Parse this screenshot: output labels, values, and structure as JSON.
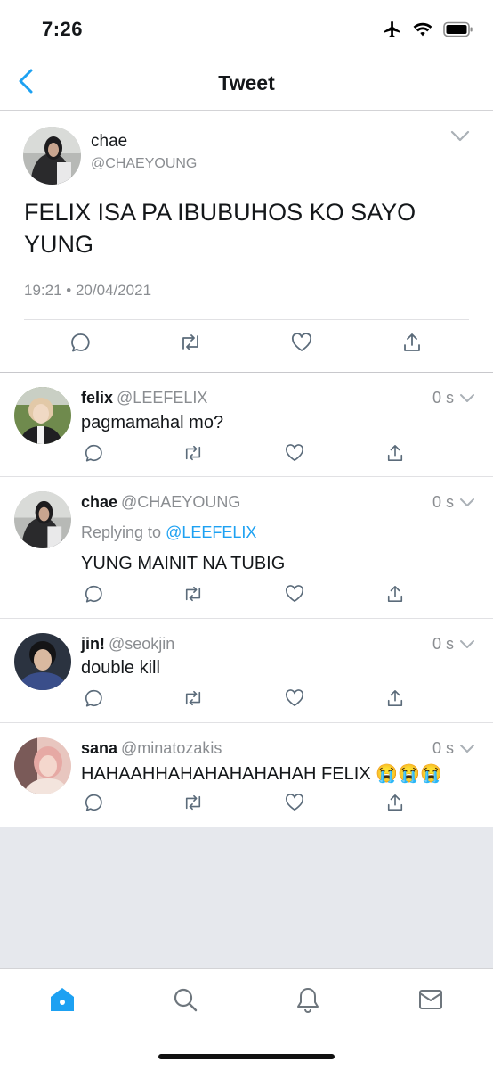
{
  "status_bar": {
    "time": "7:26"
  },
  "nav": {
    "title": "Tweet"
  },
  "main_tweet": {
    "name": "chae",
    "handle": "@CHAEYOUNG",
    "text": "FELIX ISA PA IBUBUHOS KO SAYO YUNG",
    "timestamp": "19:21 • 20/04/2021"
  },
  "replies": [
    {
      "name": "felix",
      "handle": "@LEEFELIX",
      "age": "0 s",
      "text": "pagmamahal mo?"
    },
    {
      "name": "chae",
      "handle": "@CHAEYOUNG",
      "age": "0 s",
      "replying_prefix": "Replying to",
      "replying_to": "@LEEFELIX",
      "text": "YUNG MAINIT NA TUBIG"
    },
    {
      "name": "jin!",
      "handle": "@seokjin",
      "age": "0 s",
      "text": "double kill"
    },
    {
      "name": "sana",
      "handle": "@minatozakis",
      "age": "0 s",
      "text": "HAHAAHHAHAHAHAHAHAH FELIX 😭😭😭"
    }
  ],
  "icons": {
    "back": "chevron-left-icon",
    "more": "chevron-down-icon",
    "reply": "reply-icon",
    "retweet": "retweet-icon",
    "like": "heart-icon",
    "share": "share-icon",
    "tabs": [
      "home-icon",
      "search-icon",
      "bell-icon",
      "mail-icon"
    ]
  },
  "colors": {
    "accent": "#1da1f2",
    "muted": "#8a8d91",
    "background_empty": "#e6e8ed"
  }
}
